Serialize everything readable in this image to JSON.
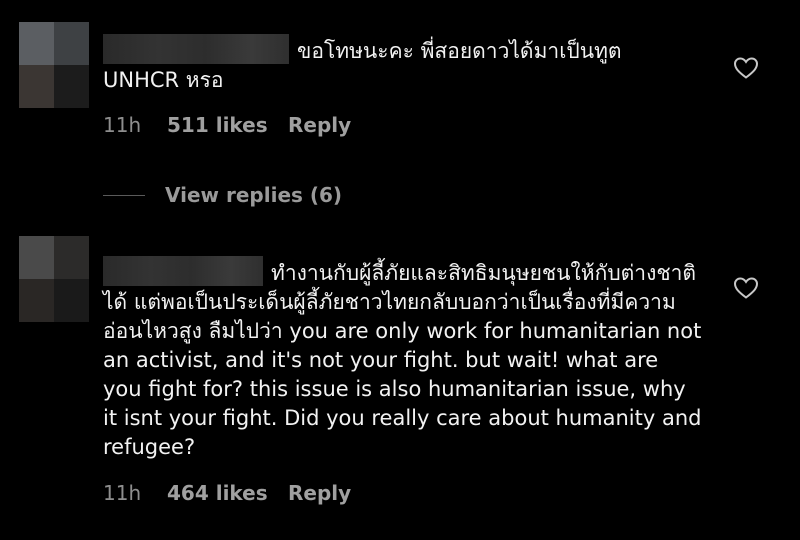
{
  "comments": [
    {
      "text": "ขอโทษนะคะ พี่สอยดาวได้มาเป็นทูต UNHCR หรอ",
      "time": "11h",
      "likes": "511 likes",
      "reply_label": "Reply"
    },
    {
      "text": "ทำงานกับผู้ลี้ภัยและสิทธิมนุษยชนให้กับต่างชาติได้ แต่พอเป็นประเด็นผู้ลี้ภัยชาวไทยกลับบอกว่าเป็นเรื่องที่มีความอ่อนไหวสูง ลืมไปว่า you are only work for humanitarian not an activist, and it's not your fight. but wait! what are you fight for? this issue is also humanitarian issue, why it isnt your fight. Did you really care about humanity and refugee?",
      "time": "11h",
      "likes": "464 likes",
      "reply_label": "Reply"
    }
  ],
  "view_replies": "View replies (6)",
  "icons": {
    "like": "heart-outline-icon"
  },
  "colors": {
    "background": "#000000",
    "text": "#f2f2f2",
    "meta": "#8e8e8e"
  }
}
